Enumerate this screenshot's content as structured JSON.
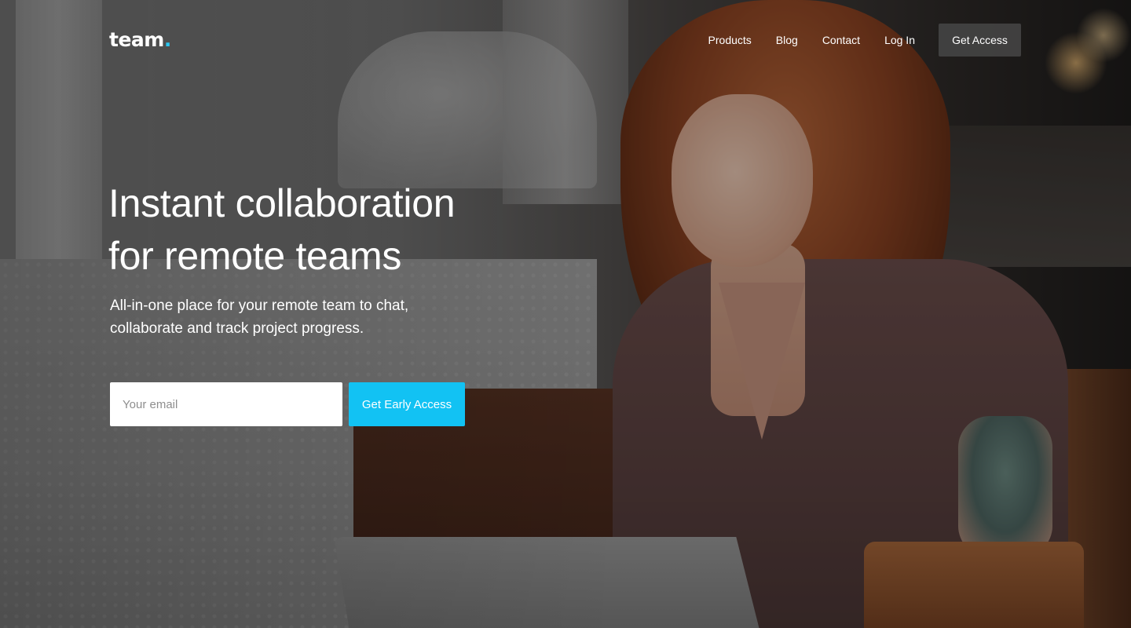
{
  "brand": {
    "name": "team",
    "dot": "."
  },
  "nav": {
    "items": [
      "Products",
      "Blog",
      "Contact",
      "Log In"
    ],
    "cta_label": "Get Access"
  },
  "hero": {
    "title_line1": "Instant collaboration",
    "title_line2": "for remote teams",
    "subtitle_line1": "All-in-one place for your remote team to chat,",
    "subtitle_line2": "collaborate and track project progress.",
    "email_placeholder": "Your email",
    "cta_label": "Get Early Access"
  },
  "colors": {
    "accent": "#12c2f3",
    "logo_dot": "#2bc6f0",
    "nav_cta_bg": "#464646"
  }
}
